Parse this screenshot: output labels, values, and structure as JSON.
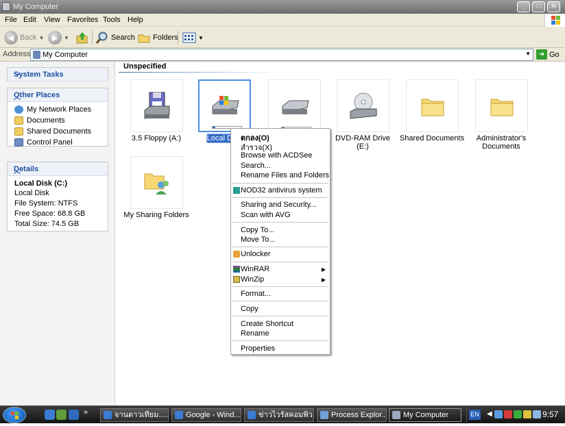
{
  "window": {
    "title": "My Computer"
  },
  "menubar": {
    "items": [
      "File",
      "Edit",
      "View",
      "Favorites",
      "Tools",
      "Help"
    ]
  },
  "toolbar": {
    "back": "Back",
    "search": "Search",
    "folders": "Folders"
  },
  "address": {
    "label": "Address",
    "value": "My Computer",
    "go": "Go"
  },
  "sidebar": {
    "system_tasks": {
      "title": "System Tasks"
    },
    "other_places": {
      "title": "Other Places",
      "items": [
        "My Network Places",
        "Documents",
        "Shared Documents",
        "Control Panel"
      ]
    },
    "details": {
      "title": "Details",
      "name": "Local Disk (C:)",
      "type": "Local Disk",
      "fs": "File System: NTFS",
      "free": "Free Space: 68.8 GB",
      "total": "Total Size: 74.5 GB"
    }
  },
  "content": {
    "group": "Unspecified",
    "items": [
      "3.5 Floppy (A:)",
      "Local Disk",
      "",
      "DVD-RAM Drive (E:)",
      "Shared Documents",
      "Administrator's Documents",
      "My Sharing Folders"
    ]
  },
  "context_menu": {
    "open": "ตกลง(O)",
    "explore": "สำรวจ(X)",
    "browse_acdsee": "Browse with ACDSee",
    "search": "Search...",
    "rename_files": "Rename Files and Folders",
    "nod32": "NOD32 antivirus system",
    "sharing": "Sharing and Security...",
    "scan_avg": "Scan with AVG",
    "copy_to": "Copy To...",
    "move_to": "Move To...",
    "unlocker": "Unlocker",
    "winrar": "WinRAR",
    "winzip": "WinZip",
    "format": "Format...",
    "copy": "Copy",
    "create_shortcut": "Create Shortcut",
    "rename": "Rename",
    "properties": "Properties"
  },
  "taskbar": {
    "buttons": [
      "จานดาวเทียม......",
      "Google - Wind...",
      "ข่าวไวรัสคอมพิว...",
      "Process Explor...",
      "My Computer"
    ],
    "lang": "EN",
    "clock": "9:57"
  }
}
